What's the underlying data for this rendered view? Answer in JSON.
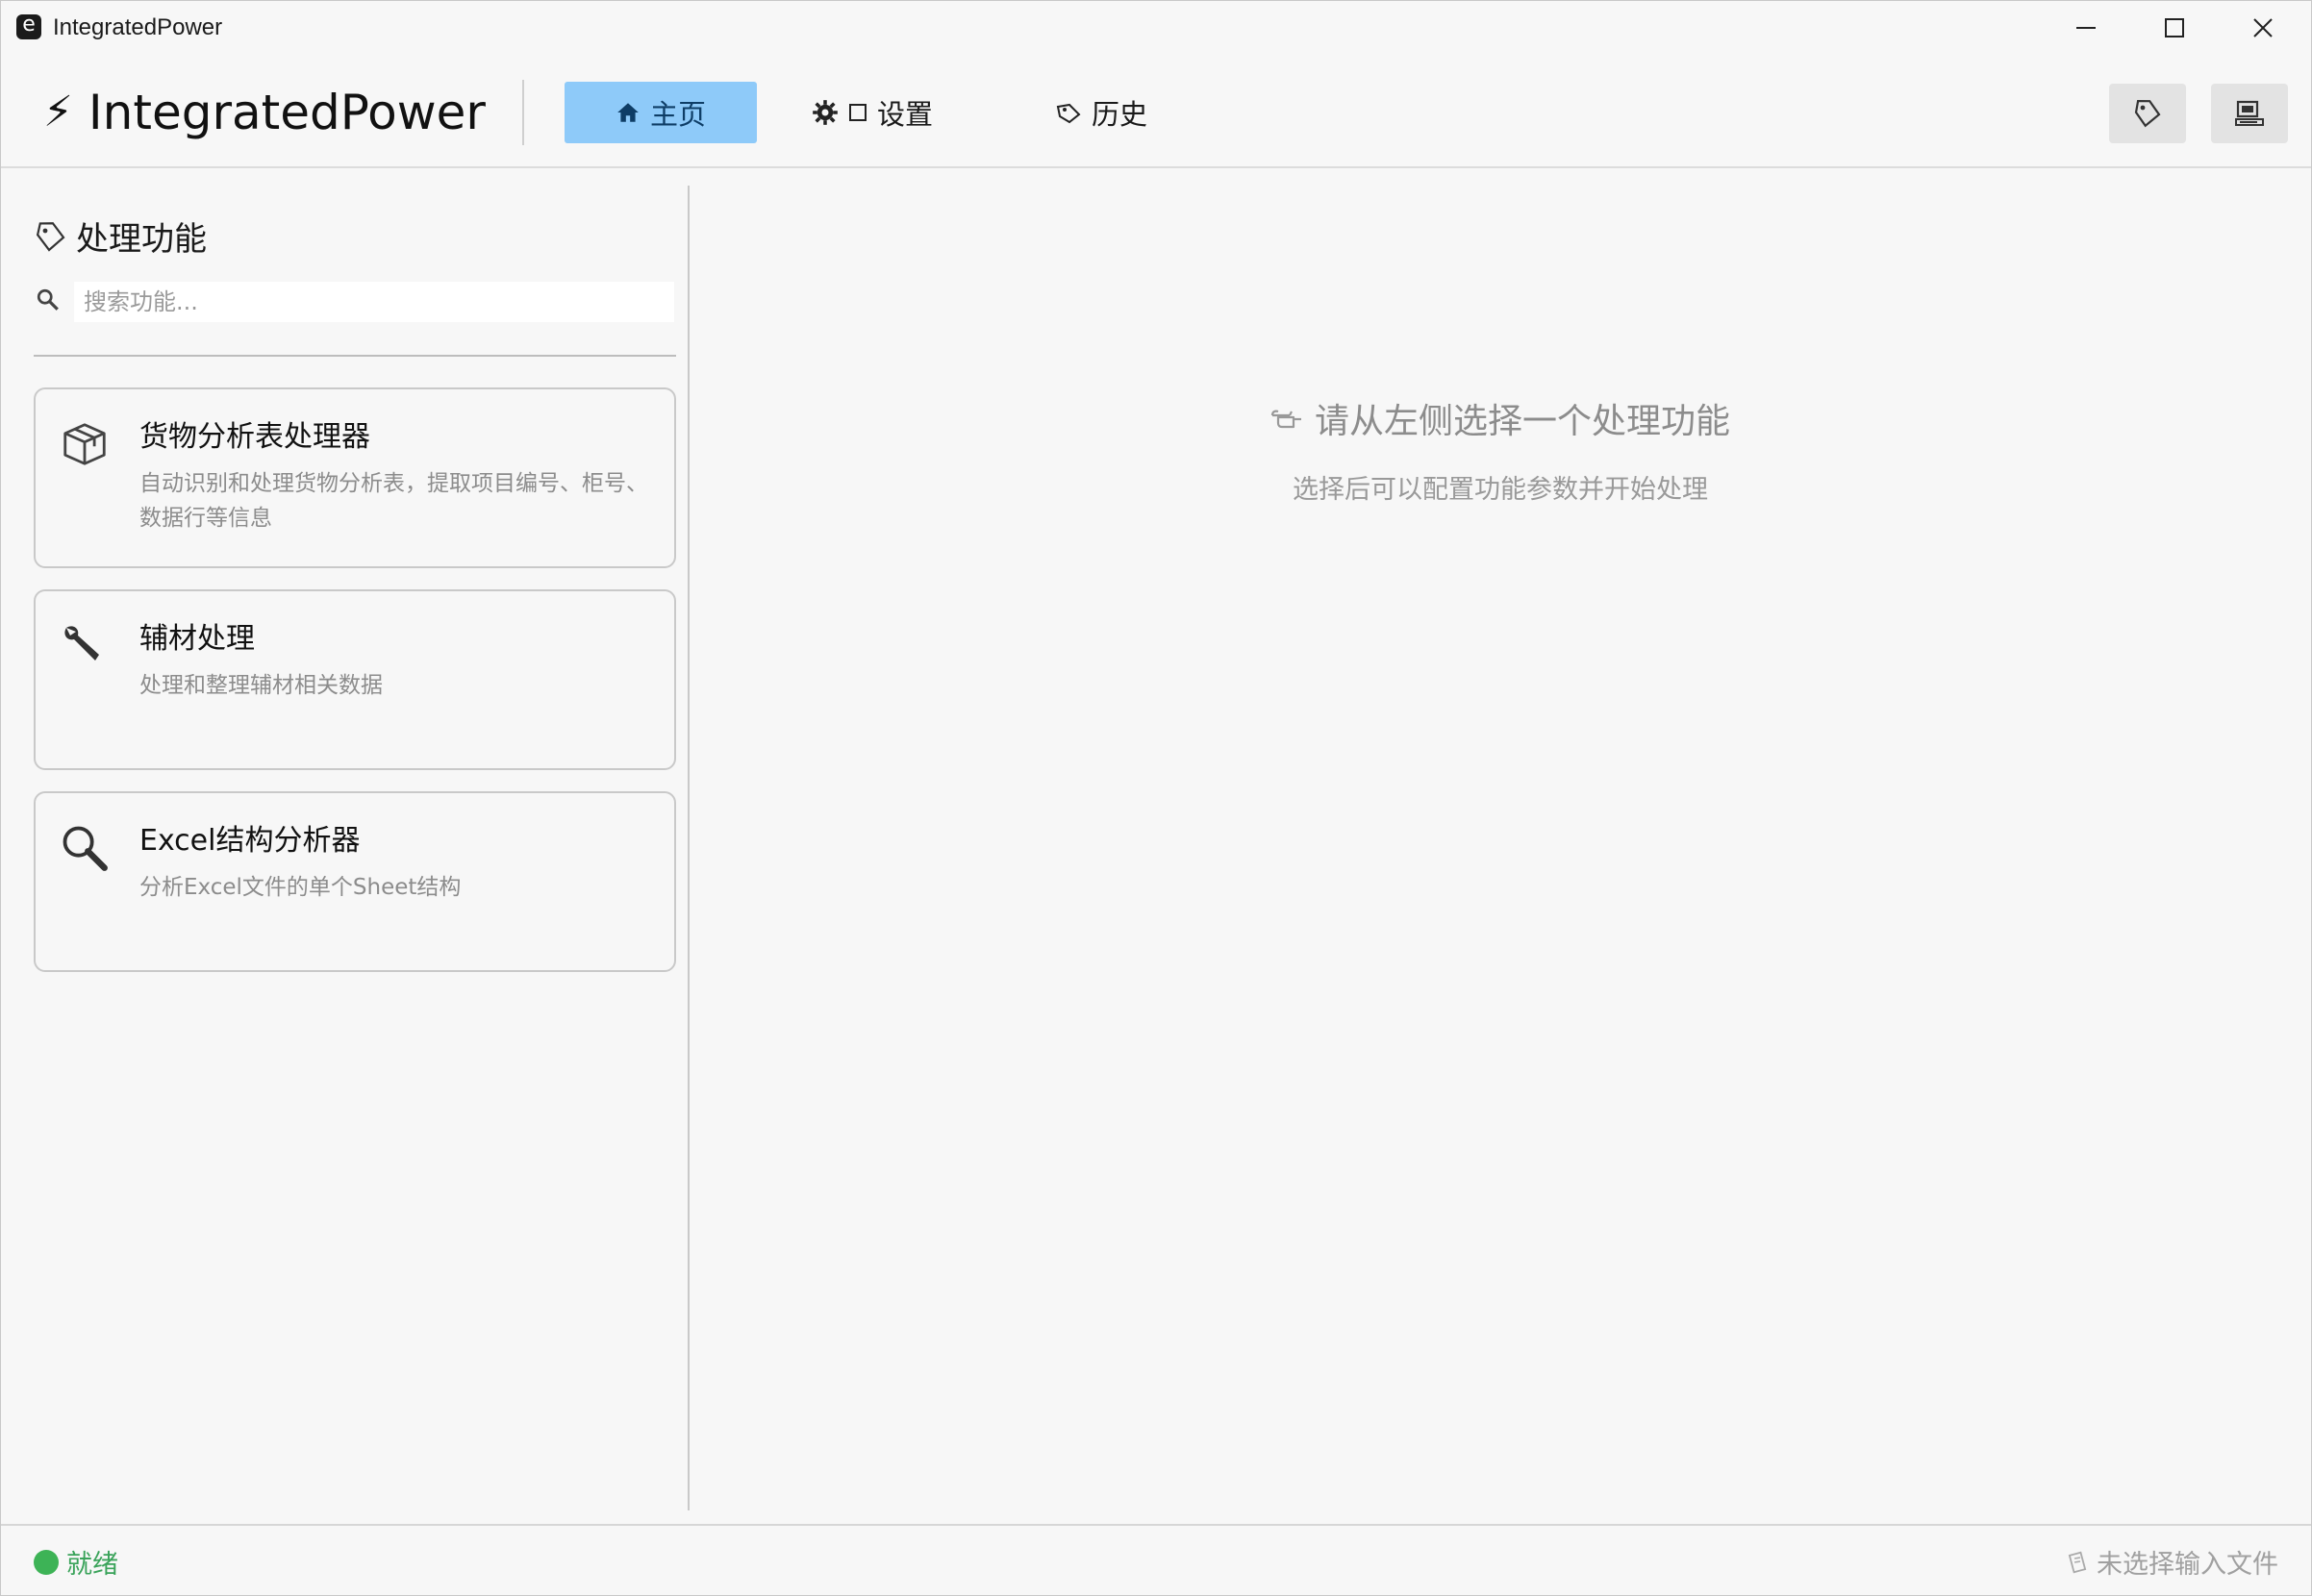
{
  "window": {
    "title": "IntegratedPower",
    "app_icon_letter": "e"
  },
  "header": {
    "brand_symbol": "⚡",
    "brand_name": "IntegratedPower",
    "tabs": [
      {
        "icon": "home-icon",
        "label": "主页",
        "active": true
      },
      {
        "icon": "gear-icon",
        "label": "设置",
        "active": false
      },
      {
        "icon": "tag-icon",
        "label": "历史",
        "active": false
      }
    ],
    "right_buttons": [
      "tag-icon",
      "computer-icon"
    ]
  },
  "sidebar": {
    "heading": "处理功能",
    "search": {
      "placeholder": "搜索功能...",
      "value": ""
    },
    "items": [
      {
        "icon": "package-icon",
        "title": "货物分析表处理器",
        "description": "自动识别和处理货物分析表，提取项目编号、柜号、数据行等信息"
      },
      {
        "icon": "wrench-icon",
        "title": "辅材处理",
        "description": "处理和整理辅材相关数据"
      },
      {
        "icon": "magnifier-icon",
        "title": "Excel结构分析器",
        "description": "分析Excel文件的单个Sheet结构"
      }
    ]
  },
  "main": {
    "placeholder_title": "请从左侧选择一个处理功能",
    "placeholder_subtitle": "选择后可以配置功能参数并开始处理"
  },
  "status": {
    "state": "就绪",
    "file_info": "未选择输入文件"
  },
  "colors": {
    "active_tab": "#8ecaf9",
    "status_ok": "#3db356",
    "muted_text": "#8c8c8c"
  }
}
